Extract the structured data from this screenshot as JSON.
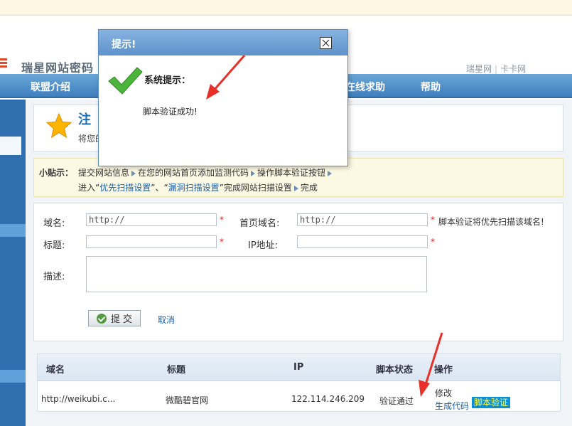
{
  "header": {
    "site_title": "瑞星网站密码",
    "links": [
      "瑞星网",
      "卡卡网"
    ],
    "link_sep": "|"
  },
  "nav": {
    "items": [
      "联盟介绍",
      "在线求助",
      "帮助"
    ]
  },
  "register": {
    "title": "注",
    "subtitle": "将您的"
  },
  "tips": {
    "label": "小贴示：",
    "step1": "提交网站信息",
    "step2": "在您的网站首页添加监测代码",
    "step3": "操作脚本验证按钮",
    "step4_prefix": "进入“",
    "step4_link1": "优先扫描设置",
    "step4_mid": "”、“",
    "step4_link2": "漏洞扫描设置",
    "step4_suffix": "”完成网站扫描设置",
    "step5": "完成"
  },
  "form": {
    "domain_label": "域名:",
    "domain_value": "http://",
    "homepage_label": "首页域名:",
    "homepage_value": "http://",
    "homepage_note": "脚本验证将优先扫描该域名!",
    "title_label": "标题:",
    "ip_label": "IP地址:",
    "desc_label": "描述:",
    "required_mark": "*",
    "submit_label": "提 交",
    "cancel_label": "取消"
  },
  "table": {
    "headers": [
      "域名",
      "标题",
      "IP",
      "脚本状态",
      "操作"
    ],
    "rows": [
      {
        "domain": "http://weikubi.c...",
        "title": "微酷碧官网",
        "ip": "122.114.246.209",
        "status": "验证通过",
        "action_edit": "修改",
        "action_gen": "生成代码",
        "action_verify": "脚本验证"
      }
    ]
  },
  "dialog": {
    "title": "提示!",
    "heading": "系统提示：",
    "message": "脚本验证成功!"
  },
  "colors": {
    "nav_blue": "#3f7fbf",
    "link_blue": "#1b5fa8",
    "required_red": "#e02020",
    "annotation_red": "#e8302a",
    "badge_bg": "#0a8fd8",
    "badge_text": "#ffff4a"
  }
}
